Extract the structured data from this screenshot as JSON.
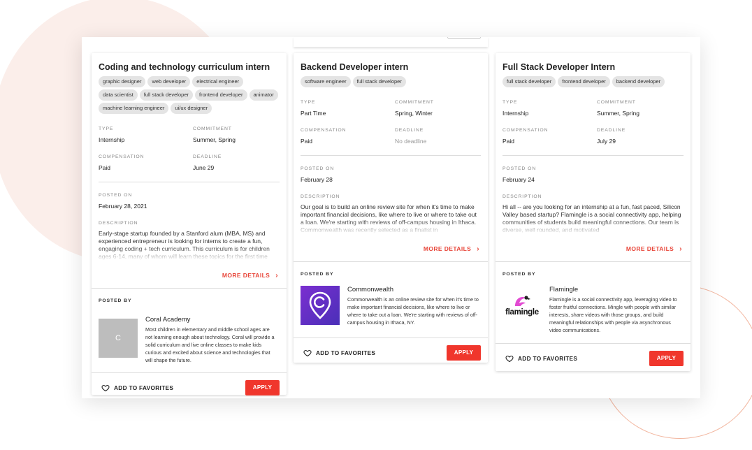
{
  "cards": [
    {
      "title": "Coding and technology curriculum intern",
      "tags": [
        "graphic designer",
        "web developer",
        "electrical engineer",
        "data scientist",
        "full stack developer",
        "frontend developer",
        "animator",
        "machine learning engineer",
        "ui/ux designer"
      ],
      "type_label": "TYPE",
      "type": "Internship",
      "commitment_label": "COMMITMENT",
      "commitment": "Summer, Spring",
      "compensation_label": "COMPENSATION",
      "compensation": "Paid",
      "deadline_label": "DEADLINE",
      "deadline": "June 29",
      "posted_on_label": "POSTED ON",
      "posted_on": "February 28, 2021",
      "description_label": "DESCRIPTION",
      "description": "Early-stage startup founded by a Stanford alum (MBA, MS) and experienced entrepreneur is looking for interns to create a fun, engaging coding + tech curriculum. This curriculum is for children ages 6-14, many of whom will learn these topics for the first time",
      "more_details": "MORE DETAILS",
      "posted_by_label": "POSTED BY",
      "org_name": "Coral Academy",
      "org_initial": "C",
      "org_description": "Most children in elementary and middle school ages are not learning enough about technology. Coral will provide a solid curriculum and live online classes to make kids curious and excited about science and technologies that will shape the future.",
      "favorites": "ADD TO FAVORITES",
      "apply": "APPLY"
    },
    {
      "title": "Backend Developer intern",
      "tags": [
        "software engineer",
        "full stack developer"
      ],
      "type_label": "TYPE",
      "type": "Part Time",
      "commitment_label": "COMMITMENT",
      "commitment": "Spring, Winter",
      "compensation_label": "COMPENSATION",
      "compensation": "Paid",
      "deadline_label": "DEADLINE",
      "deadline": "No deadline",
      "posted_on_label": "POSTED ON",
      "posted_on": "February 28",
      "description_label": "DESCRIPTION",
      "description": "Our goal is to build an online review site for when it's time to make important financial decisions, like where to live or where to take out a loan. We're starting with reviews of off-campus housing in Ithaca. Commonwealth was recently selected as a finalist in",
      "more_details": "MORE DETAILS",
      "posted_by_label": "POSTED BY",
      "org_name": "Commonwealth",
      "org_description": "Commonwealth is an online review site for when it's time to make important financial decisions, like where to live or where to take out a loan. We're starting with reviews of off-campus housing in Ithaca, NY.",
      "favorites": "ADD TO FAVORITES",
      "apply": "APPLY"
    },
    {
      "title": "Full Stack Developer Intern",
      "tags": [
        "full stack developer",
        "frontend developer",
        "backend developer"
      ],
      "type_label": "TYPE",
      "type": "Internship",
      "commitment_label": "COMMITMENT",
      "commitment": "Summer, Spring",
      "compensation_label": "COMPENSATION",
      "compensation": "Paid",
      "deadline_label": "DEADLINE",
      "deadline": "July 29",
      "posted_on_label": "POSTED ON",
      "posted_on": "February 24",
      "description_label": "DESCRIPTION",
      "description": "Hi all -- are you looking for an internship at a fun, fast paced, Silicon Valley based startup? Flamingle is a social connectivity app, helping communities of students build meaningful connections. Our team is diverse, well rounded, and motivated",
      "more_details": "MORE DETAILS",
      "posted_by_label": "POSTED BY",
      "org_name": "Flamingle",
      "org_logo_text": "flamingle",
      "org_description": "Flamingle is a social connectivity app, leveraging video to foster fruitful connections. Mingle with people with similar interests, share videos with those groups, and build meaningful relationships with people via asynchronous video communications.",
      "favorites": "ADD TO FAVORITES",
      "apply": "APPLY"
    }
  ],
  "colors": {
    "accent": "#f0362c",
    "link": "#e8463a",
    "tag_bg": "#e4e4e4",
    "commonwealth_purple": "#6a2fc4"
  }
}
